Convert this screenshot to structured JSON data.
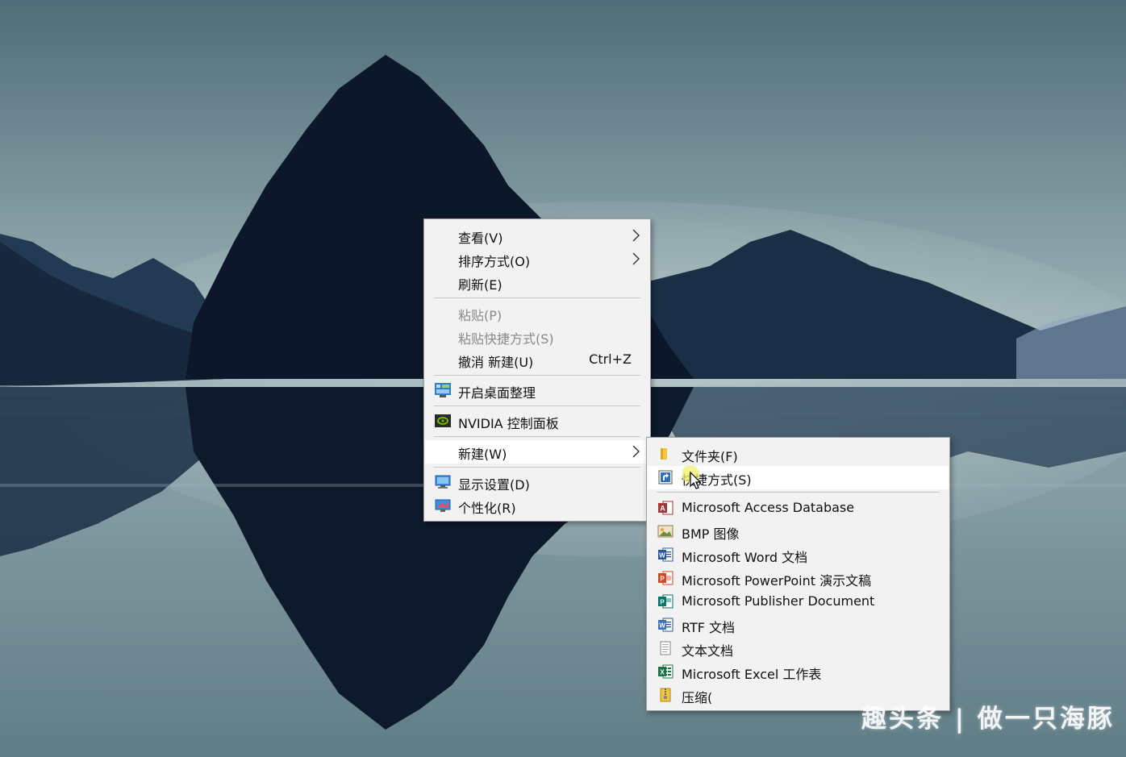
{
  "context_menu": {
    "items": [
      {
        "label": "查看(V)"
      },
      {
        "label": "排序方式(O)"
      },
      {
        "label": "刷新(E)"
      },
      {
        "label": "粘贴(P)"
      },
      {
        "label": "粘贴快捷方式(S)"
      },
      {
        "label": "撤消 新建(U)",
        "shortcut": "Ctrl+Z"
      },
      {
        "label": "开启桌面整理"
      },
      {
        "label": "NVIDIA 控制面板"
      },
      {
        "label": "新建(W)"
      },
      {
        "label": "显示设置(D)"
      },
      {
        "label": "个性化(R)"
      }
    ]
  },
  "new_submenu": {
    "items": [
      {
        "label": "文件夹(F)"
      },
      {
        "label": "快捷方式(S)"
      },
      {
        "label": "Microsoft Access Database"
      },
      {
        "label": "BMP 图像"
      },
      {
        "label": "Microsoft Word 文档"
      },
      {
        "label": "Microsoft PowerPoint 演示文稿"
      },
      {
        "label": "Microsoft Publisher Document"
      },
      {
        "label": "RTF 文档"
      },
      {
        "label": "文本文档"
      },
      {
        "label": "Microsoft Excel 工作表"
      },
      {
        "label": "压缩("
      }
    ]
  },
  "watermark": "趣头条 | 做一只海豚",
  "icons": [
    "chevron-right-icon",
    "desktop-organize-icon",
    "nvidia-icon",
    "display-icon",
    "personalize-icon",
    "folder-icon",
    "shortcut-icon",
    "access-icon",
    "bmp-icon",
    "word-icon",
    "powerpoint-icon",
    "publisher-icon",
    "rtf-icon",
    "text-file-icon",
    "excel-icon",
    "zip-icon",
    "mouse-cursor-icon"
  ],
  "colors": {
    "menu_bg": "#f2f2f2",
    "highlight": "#ffffff",
    "disabled_text": "#8a8a8a"
  }
}
